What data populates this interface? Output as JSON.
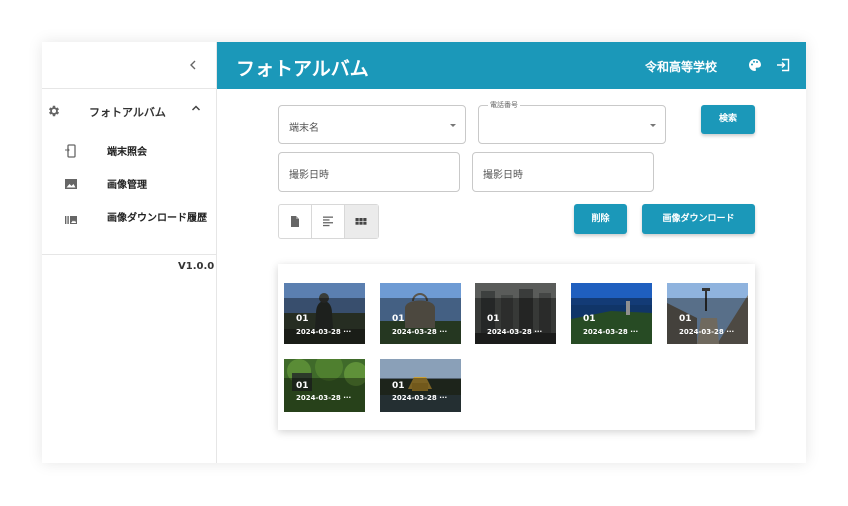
{
  "sidebar": {
    "collapse_icon": "chevron-left-icon",
    "group_label": "フォトアルバム",
    "items": [
      {
        "label": "端末照会",
        "icon": "device-icon"
      },
      {
        "label": "画像管理",
        "icon": "image-icon"
      },
      {
        "label": "画像ダウンロード履歴",
        "icon": "photo-library-icon"
      }
    ],
    "version": "V1.0.0"
  },
  "header": {
    "title": "フォトアルバム",
    "school": "令和高等学校",
    "accent_color": "#1b98b9"
  },
  "form": {
    "terminal_name_placeholder": "端末名",
    "phone_label": "電話番号",
    "phone_value": "",
    "date_from_placeholder": "撮影日時",
    "date_to_placeholder": "撮影日時",
    "search_label": "検索",
    "delete_label": "削除",
    "download_label": "画像ダウンロード"
  },
  "gallery": {
    "photos": [
      {
        "num": "01",
        "date": "2024-03-28 ···"
      },
      {
        "num": "01",
        "date": "2024-03-28 ···"
      },
      {
        "num": "01",
        "date": "2024-03-28 ···"
      },
      {
        "num": "01",
        "date": "2024-03-28 ···"
      },
      {
        "num": "01",
        "date": "2024-03-28 ···"
      },
      {
        "num": "01",
        "date": "2024-03-28 ···"
      },
      {
        "num": "01",
        "date": "2024-03-28 ···"
      }
    ]
  }
}
